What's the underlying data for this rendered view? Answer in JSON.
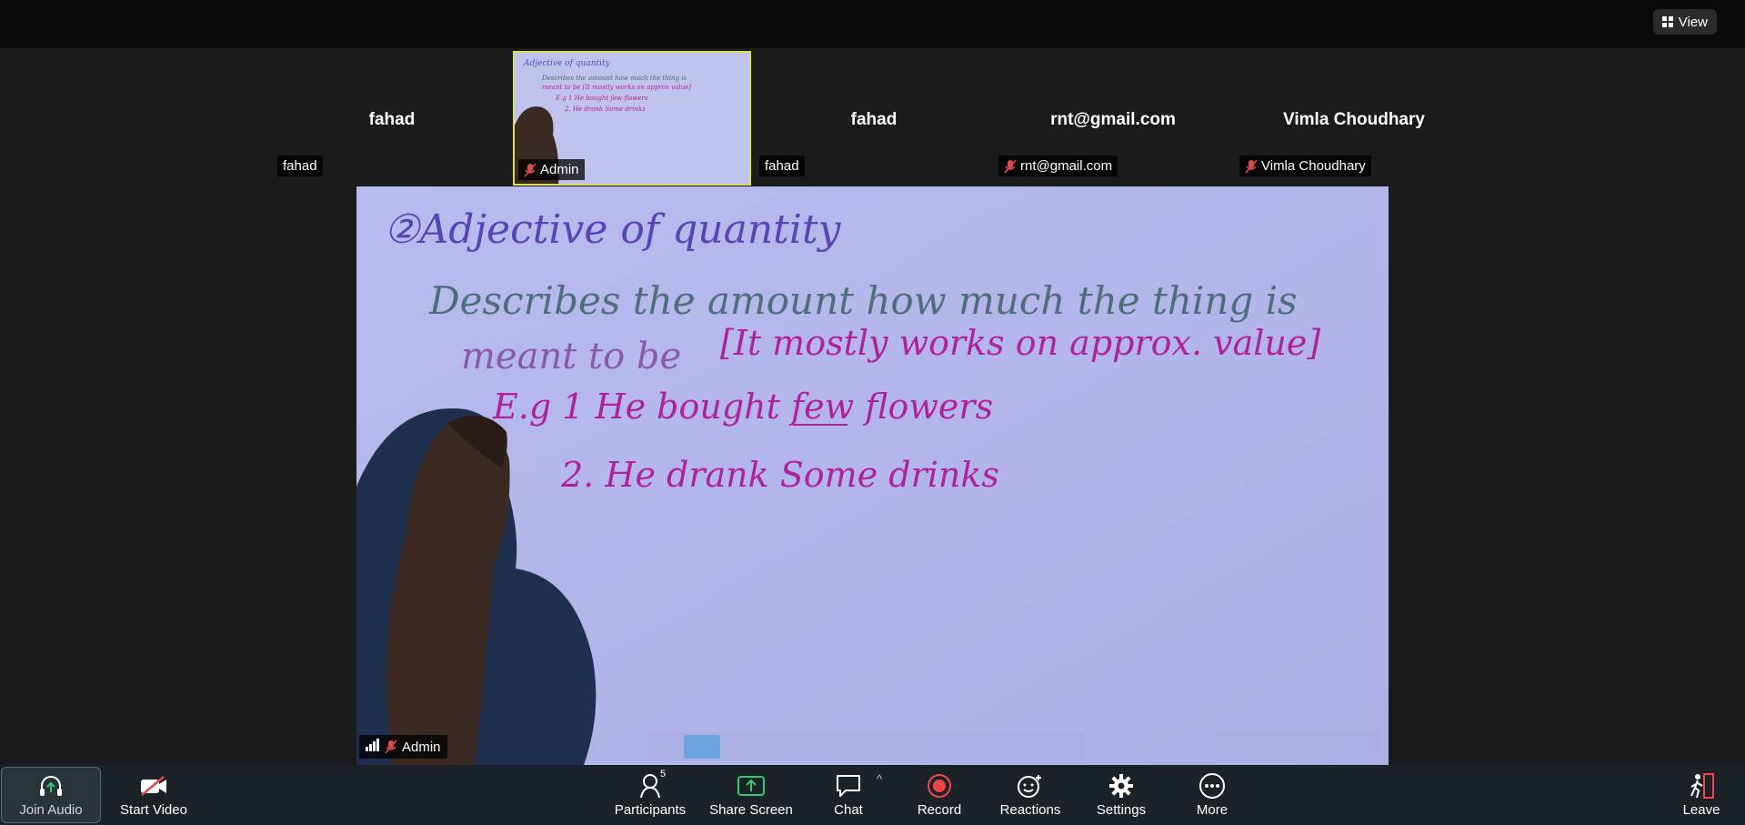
{
  "topbar": {
    "view_label": "View"
  },
  "participants_strip": [
    {
      "name_big": "fahad",
      "label": "fahad"
    },
    {
      "name_big": "",
      "label": "Admin"
    },
    {
      "name_big": "fahad",
      "label": "fahad"
    },
    {
      "name_big": "rnt@gmail.com",
      "label": "rnt@gmail.com"
    },
    {
      "name_big": "Vimla Choudhary",
      "label": "Vimla Choudhary"
    }
  ],
  "whiteboard": {
    "heading": "②Adjective of quantity",
    "line1": "Describes the amount how much the thing is",
    "line2a": "meant to be",
    "line2b": "[It mostly works on approx. value]",
    "ex1": "E.g 1 He bought few flowers",
    "ex2": "2. He drank Some drinks"
  },
  "main_video": {
    "label": "Admin"
  },
  "toolbar": {
    "join_audio": "Join Audio",
    "start_video": "Start Video",
    "participants": "Participants",
    "participants_count": "5",
    "share_screen": "Share Screen",
    "chat": "Chat",
    "record": "Record",
    "reactions": "Reactions",
    "settings": "Settings",
    "more": "More",
    "leave": "Leave"
  },
  "colors": {
    "accent_green": "#2ecc71",
    "record_red": "#f44646",
    "thumb_border": "#d6e05a",
    "board": "#b3b6ea"
  }
}
